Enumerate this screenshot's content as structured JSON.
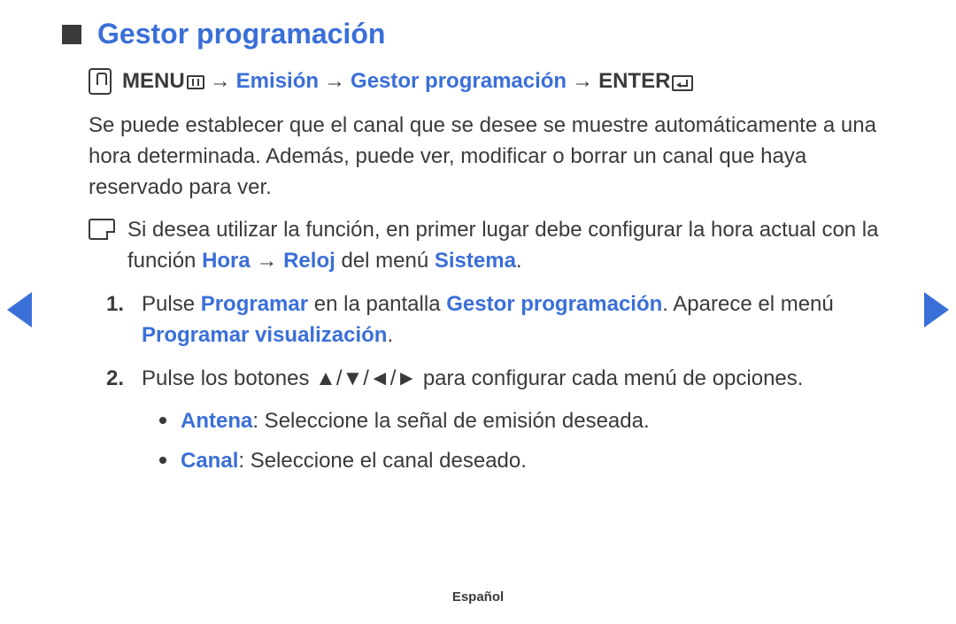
{
  "title": "Gestor programación",
  "path": {
    "menu": "MENU",
    "link1": "Emisión",
    "link2": "Gestor programación",
    "enter": "ENTER",
    "arrow": "→"
  },
  "paragraph": "Se puede establecer que el canal que se desee se muestre automáticamente a una hora determinada. Además, puede ver, modificar o borrar un canal que haya reservado para ver.",
  "note": {
    "pre": "Si desea utilizar la función, en primer lugar debe configurar la hora actual con la función ",
    "link1": "Hora",
    "arrow": "→",
    "link2": "Reloj",
    "mid": " del menú ",
    "link3": "Sistema",
    "end": "."
  },
  "step1": {
    "num": "1.",
    "t1": "Pulse ",
    "l1": "Programar",
    "t2": " en la pantalla ",
    "l2": "Gestor programación",
    "t3": ". Aparece el menú ",
    "l3": "Programar visualización",
    "t4": "."
  },
  "step2": {
    "num": "2.",
    "t1": "Pulse los botones ",
    "arrows": "▲/▼/◄/►",
    "t2": " para configurar cada menú de opciones."
  },
  "bullets": {
    "b1_label": "Antena",
    "b1_text": ": Seleccione la señal de emisión deseada.",
    "b2_label": "Canal",
    "b2_text": ": Seleccione el canal deseado."
  },
  "footer": "Español"
}
